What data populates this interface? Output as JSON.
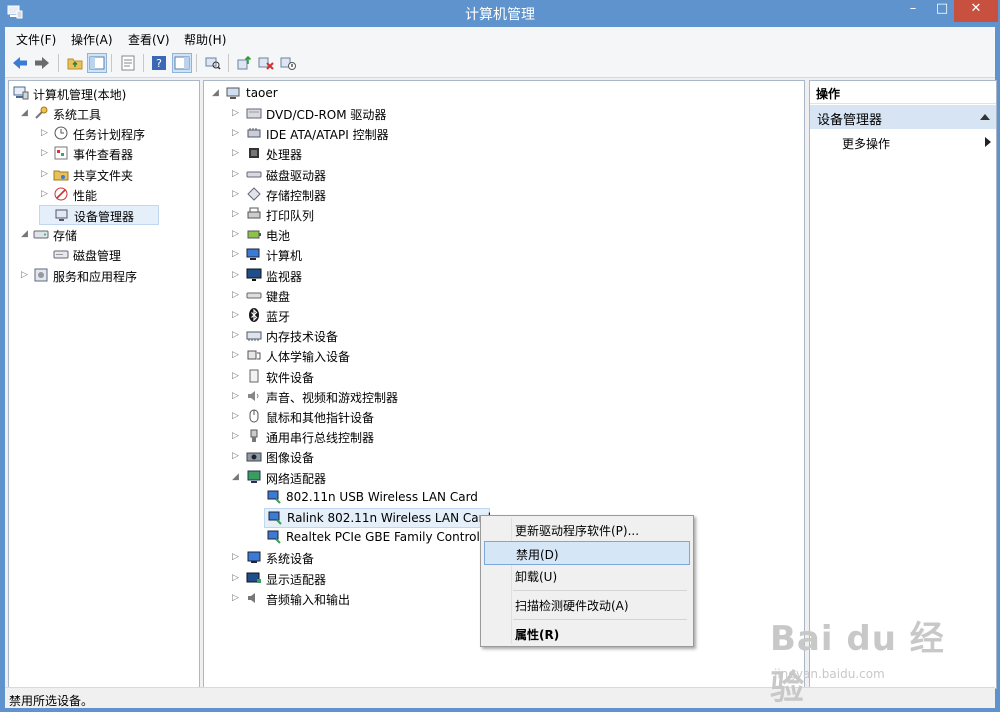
{
  "window": {
    "title": "计算机管理",
    "min_glyph": "–",
    "max_glyph": "□",
    "close_glyph": "✕"
  },
  "menu": [
    "文件(F)",
    "操作(A)",
    "查看(V)",
    "帮助(H)"
  ],
  "left_tree": {
    "root": "计算机管理(本地)",
    "items": [
      {
        "label": "系统工具",
        "icon": "tools-icon",
        "expanded": true
      },
      {
        "label": "任务计划程序",
        "icon": "clock-icon"
      },
      {
        "label": "事件查看器",
        "icon": "event-viewer-icon"
      },
      {
        "label": "共享文件夹",
        "icon": "shared-folder-icon"
      },
      {
        "label": "性能",
        "icon": "performance-icon"
      },
      {
        "label": "设备管理器",
        "icon": "device-manager-icon",
        "selected": true
      },
      {
        "label": "存储",
        "icon": "storage-icon",
        "expanded": true
      },
      {
        "label": "磁盘管理",
        "icon": "disk-management-icon"
      },
      {
        "label": "服务和应用程序",
        "icon": "services-icon"
      }
    ]
  },
  "device_tree": {
    "root": "taoer",
    "categories": [
      {
        "label": "DVD/CD-ROM 驱动器",
        "icon": "dvd-drive-icon"
      },
      {
        "label": "IDE ATA/ATAPI 控制器",
        "icon": "ide-controller-icon"
      },
      {
        "label": "处理器",
        "icon": "processor-icon"
      },
      {
        "label": "磁盘驱动器",
        "icon": "disk-drive-icon"
      },
      {
        "label": "存储控制器",
        "icon": "storage-controller-icon"
      },
      {
        "label": "打印队列",
        "icon": "printer-icon"
      },
      {
        "label": "电池",
        "icon": "battery-icon"
      },
      {
        "label": "计算机",
        "icon": "computer-icon"
      },
      {
        "label": "监视器",
        "icon": "monitor-icon"
      },
      {
        "label": "键盘",
        "icon": "keyboard-icon"
      },
      {
        "label": "蓝牙",
        "icon": "bluetooth-icon"
      },
      {
        "label": "内存技术设备",
        "icon": "memory-device-icon"
      },
      {
        "label": "人体学输入设备",
        "icon": "hid-icon"
      },
      {
        "label": "软件设备",
        "icon": "software-device-icon"
      },
      {
        "label": "声音、视频和游戏控制器",
        "icon": "sound-icon"
      },
      {
        "label": "鼠标和其他指针设备",
        "icon": "mouse-icon"
      },
      {
        "label": "通用串行总线控制器",
        "icon": "usb-icon"
      },
      {
        "label": "图像设备",
        "icon": "camera-icon"
      },
      {
        "label": "网络适配器",
        "icon": "network-adapter-icon",
        "expanded": true
      }
    ],
    "network_children": [
      "802.11n USB Wireless LAN Card",
      "Ralink 802.11n Wireless LAN Card",
      "Realtek PCIe GBE Family Controller"
    ],
    "after": [
      {
        "label": "系统设备",
        "icon": "system-device-icon"
      },
      {
        "label": "显示适配器",
        "icon": "display-adapter-icon"
      },
      {
        "label": "音频输入和输出",
        "icon": "audio-io-icon"
      }
    ]
  },
  "actions": {
    "header": "操作",
    "group": "设备管理器",
    "more": "更多操作"
  },
  "context_menu": [
    {
      "label": "更新驱动程序软件(P)..."
    },
    {
      "label": "禁用(D)",
      "highlighted": true
    },
    {
      "label": "卸载(U)"
    },
    {
      "label": "扫描检测硬件改动(A)"
    },
    {
      "label": "属性(R)",
      "bold": true
    }
  ],
  "status": "禁用所选设备。",
  "watermark": {
    "brand": "Bai du 经验",
    "url": "jingyan.baidu.com"
  },
  "colors": {
    "titlebar": "#5e93cd",
    "close": "#c7503f",
    "selection": "#d5e6f7"
  }
}
